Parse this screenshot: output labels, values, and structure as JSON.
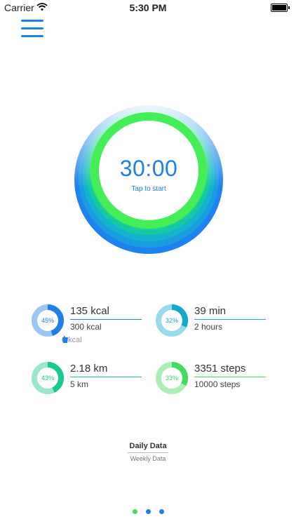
{
  "status_bar": {
    "carrier": "Carrier",
    "time": "5:30 PM"
  },
  "timer": {
    "time": "30:00",
    "hint": "Tap to start"
  },
  "stats": [
    {
      "percent": "45%",
      "value": "135 kcal",
      "goal": "300 kcal",
      "extra": "0 kcal",
      "fraction": 0.45,
      "color": "#1e7fe6",
      "light": "#9cc6f2"
    },
    {
      "percent": "32%",
      "value": "39 min",
      "goal": "2 hours",
      "fraction": 0.32,
      "color": "#16a8c9",
      "light": "#98dbe9"
    },
    {
      "percent": "43%",
      "value": "2.18 km",
      "goal": "5 km",
      "fraction": 0.43,
      "color": "#19c98f",
      "light": "#9ae8cc"
    },
    {
      "percent": "33%",
      "value": "3351 steps",
      "goal": "10000 steps",
      "fraction": 0.33,
      "color": "#3fdc5e",
      "light": "#abefb7"
    }
  ],
  "tabs": {
    "daily": "Daily Data",
    "weekly": "Weekly Data"
  },
  "colors": {
    "accent_blue": "#1e7fe6",
    "timer_text": "#1e7fe6",
    "ring_green": "#44ee55",
    "dot_active": "#44dd55",
    "dot_inactive": "#1e7fe6"
  },
  "icons": {
    "menu": "hamburger-icon",
    "wifi": "wifi-icon",
    "battery": "battery-icon",
    "cup": "cup-icon"
  },
  "pager": {
    "count": 3,
    "active": 0
  }
}
